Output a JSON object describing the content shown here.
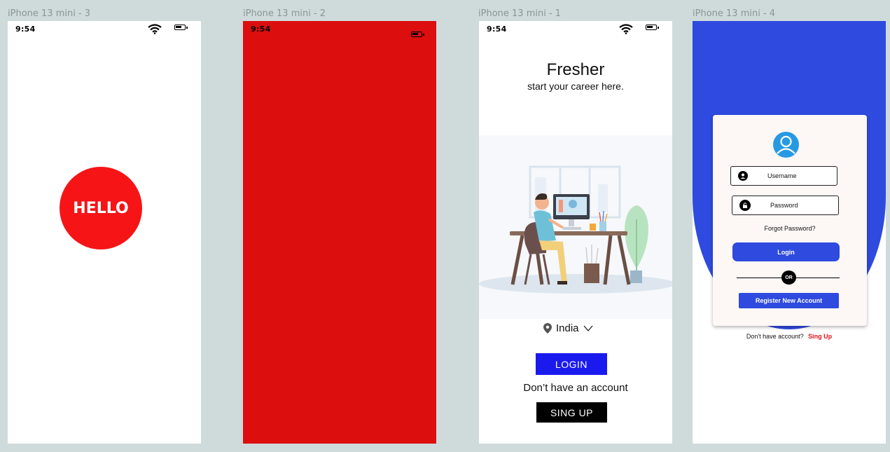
{
  "frames": {
    "f3": {
      "label": "iPhone 13 mini - 3",
      "time": "9:54",
      "hello": "HELLO"
    },
    "f2": {
      "label": "iPhone 13 mini - 2",
      "time": "9:54"
    },
    "f1": {
      "label": "iPhone 13 mini - 1",
      "time": "9:54",
      "title": "Fresher",
      "subtitle": "start your career here.",
      "country": "India",
      "login": "LOGIN",
      "no_account": "Don’t have an account",
      "signup": "SING UP"
    },
    "f4": {
      "label": "iPhone 13 mini - 4",
      "username_placeholder": "Username",
      "password_placeholder": "Password",
      "forgot": "Forgot Password?",
      "login": "Login",
      "or": "OR",
      "register": "Register New Account",
      "dont_have": "Don't have account?",
      "signup_link": "Sing Up"
    }
  },
  "colors": {
    "canvas": "#cfdadb",
    "hello_red": "#f61416",
    "splash_red": "#dc0e0e",
    "login_blue": "#1a1aef",
    "brand_blue": "#2e4adf",
    "avatar_blue": "#2799e3",
    "link_red": "#e0141a"
  },
  "icons": [
    "wifi-icon",
    "battery-icon",
    "location-pin-icon",
    "chevron-down-icon",
    "user-avatar-icon",
    "user-icon",
    "lock-icon"
  ]
}
